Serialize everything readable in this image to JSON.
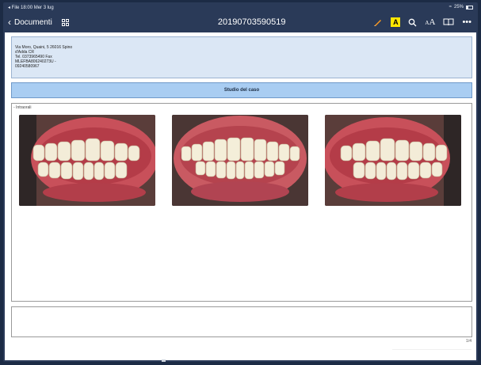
{
  "status": {
    "left": "◂ File  18:00  Mer 3 lug",
    "battery_text": "25%"
  },
  "nav": {
    "back_label": "Documenti",
    "title": "20190703590519"
  },
  "document": {
    "address_lines": [
      "Via Moro, Quaini, 5 26016 Spino",
      "d'Adda CR",
      "Tel. 0373965490 Fax",
      "MLEFBA806240273U -",
      "09240580967"
    ],
    "section_title": "Studio del caso",
    "panel_label": "- Intraorali",
    "page_number": "1/4"
  },
  "colors": {
    "navbar": "#2a3a58",
    "highlight": "#ffe600",
    "section_bar": "#a9cdf2",
    "address_bg": "#dbe7f5"
  },
  "icons": {
    "back": "chevron-left-icon",
    "grid": "grid-icon",
    "pencil": "pencil-icon",
    "highlight": "highlight-icon",
    "search": "search-icon",
    "text_size": "text-size-icon",
    "book": "book-icon",
    "more": "more-icon"
  }
}
